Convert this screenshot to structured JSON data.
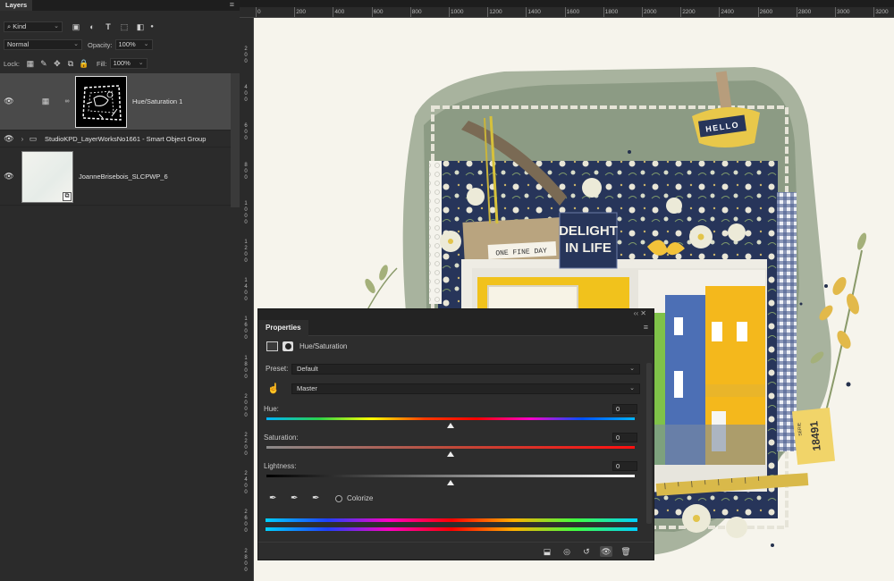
{
  "layers_panel": {
    "tab": "Layers",
    "filter": {
      "kind": "Kind"
    },
    "blend_mode": "Normal",
    "opacity_label": "Opacity:",
    "opacity_value": "100%",
    "lock_label": "Lock:",
    "fill_label": "Fill:",
    "fill_value": "100%",
    "layers": [
      {
        "name": "Hue/Saturation 1",
        "type": "adjustment",
        "selected": true
      },
      {
        "name": "StudioKPD_LayerWorksNo1661 - Smart Object Group",
        "type": "group"
      },
      {
        "name": "JoanneBrisebois_SLCPWP_6",
        "type": "smart-object"
      }
    ]
  },
  "ruler": {
    "h_ticks": [
      "0",
      "200",
      "400",
      "600",
      "800",
      "1000",
      "1200",
      "1400",
      "1600",
      "1800",
      "2000",
      "2200",
      "2400",
      "2600",
      "2800",
      "3000",
      "3200"
    ],
    "v_ticks": [
      "200",
      "400",
      "600",
      "800",
      "1000",
      "1200",
      "1400",
      "1600",
      "1800",
      "2000",
      "2200",
      "2400",
      "2600",
      "2800"
    ]
  },
  "scrapbook": {
    "hello_tag": "HELLO",
    "delight_tag_line1": "DELIGHT",
    "delight_tag_line2": "IN LIFE",
    "one_fine_day": "ONE FINE DAY",
    "ticket_text": "18491",
    "ticket_small": "SERIE"
  },
  "properties": {
    "tab": "Properties",
    "adjustment_name": "Hue/Saturation",
    "preset_label": "Preset:",
    "preset_value": "Default",
    "channel_value": "Master",
    "hue_label": "Hue:",
    "hue_value": "0",
    "saturation_label": "Saturation:",
    "saturation_value": "0",
    "lightness_label": "Lightness:",
    "lightness_value": "0",
    "colorize_label": "Colorize"
  },
  "colors": {
    "panel_bg": "#2b2b2b",
    "selected_layer": "#4a4a4a",
    "canvas_bg": "#f6f4ec",
    "navy_paper": "#27355a",
    "sage_green": "#8c9b84",
    "yellow_house": "#f4b81c",
    "blue_house": "#4c6fb5"
  }
}
